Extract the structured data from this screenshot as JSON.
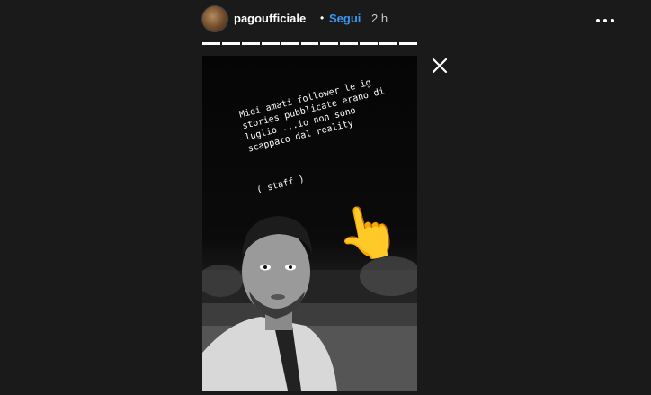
{
  "header": {
    "username": "pagoufficiale",
    "separator": "•",
    "follow_label": "Segui",
    "time_ago": "2 h"
  },
  "icons": {
    "avatar": "profile-avatar",
    "more": "more-options-icon",
    "close": "close-icon",
    "emoji": "pointing-up-emoji"
  },
  "progress": {
    "segments": 11,
    "current_segment": 11
  },
  "story": {
    "caption": "Miei amati follower le ig\nstories pubblicate erano di\nluglio ...io non sono\nscappato dal reality",
    "tag": "( staff )",
    "emoji": "👆"
  },
  "colors": {
    "background": "#1a1a1a",
    "follow": "#3897f0",
    "text": "#ffffff"
  }
}
